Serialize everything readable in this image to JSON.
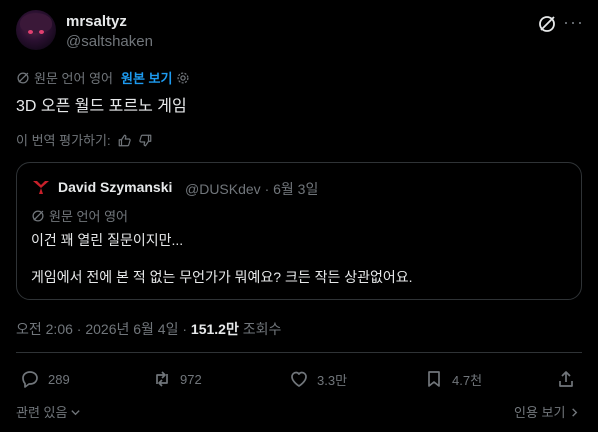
{
  "author": {
    "display_name": "mrsaltyz",
    "handle": "@saltshaken"
  },
  "header_icons": [
    "grok-icon",
    "more-options-icon"
  ],
  "translation": {
    "label": "원문 언어 영어",
    "view_original": "원본 보기"
  },
  "post": {
    "text": "3D 오픈 월드 포르노 게임"
  },
  "rate_translation": "이 번역 평가하기:",
  "quoted": {
    "display_name": "David Szymanski",
    "meta": "@DUSKdev · 6월 3일",
    "translation_label": "원문 언어 영어",
    "line1": "이건 꽤 열린 질문이지만...",
    "line2": "게임에서 전에 본 적 없는 무언가가 뭐예요? 크든 작든 상관없어요."
  },
  "timestamp": {
    "time": "오전 2:06 · 2026년 6월 4일 · ",
    "views_count": "151.2만",
    "views_label": " 조회수"
  },
  "stats": {
    "replies": "289",
    "reposts": "972",
    "likes": "3.3만",
    "bookmarks": "4.7천"
  },
  "footer": {
    "related": "관련 있음",
    "quotes": "인용 보기"
  },
  "colors": {
    "background": "#000000",
    "text": "#e7e9ea",
    "muted": "#71767b",
    "accent": "#1d9bf0",
    "border": "#2f3336"
  }
}
